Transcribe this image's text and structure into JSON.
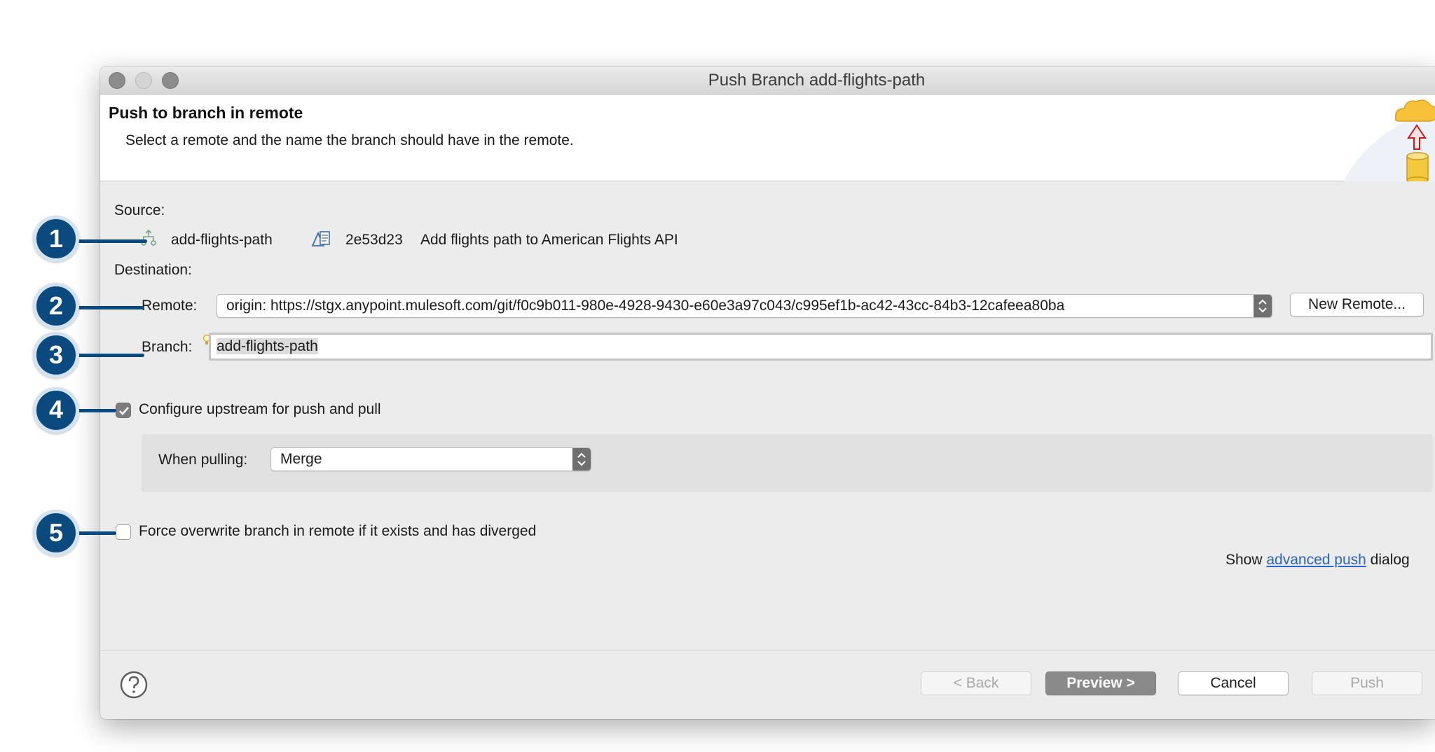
{
  "window": {
    "title": "Push Branch add-flights-path"
  },
  "banner": {
    "title": "Push to branch in remote",
    "description": "Select a remote and the name the branch should have in the remote."
  },
  "source": {
    "label": "Source:",
    "branch": "add-flights-path",
    "commit_id": "2e53d23",
    "commit_message": "Add flights path to American Flights API"
  },
  "destination": {
    "label": "Destination:",
    "remote_label": "Remote:",
    "remote_value": "origin: https://stgx.anypoint.mulesoft.com/git/f0c9b011-980e-4928-9430-e60e3a97c043/c995ef1b-ac42-43cc-84b3-12cafeea80ba",
    "new_remote_button": "New Remote...",
    "branch_label": "Branch:",
    "branch_value": "add-flights-path"
  },
  "options": {
    "configure_upstream_label": "Configure upstream for push and pull",
    "configure_upstream_checked": true,
    "when_pulling_label": "When pulling:",
    "when_pulling_value": "Merge",
    "force_overwrite_label": "Force overwrite branch in remote if it exists and has diverged",
    "force_overwrite_checked": false
  },
  "advanced": {
    "prefix": "Show",
    "link": "advanced push",
    "suffix": "dialog"
  },
  "footer": {
    "back": "< Back",
    "preview": "Preview >",
    "cancel": "Cancel",
    "push": "Push"
  },
  "callouts": [
    "1",
    "2",
    "3",
    "4",
    "5"
  ],
  "colors": {
    "callout_fill": "#0b4a7f",
    "link": "#2a63c9",
    "dialog_bg": "#ececec"
  }
}
